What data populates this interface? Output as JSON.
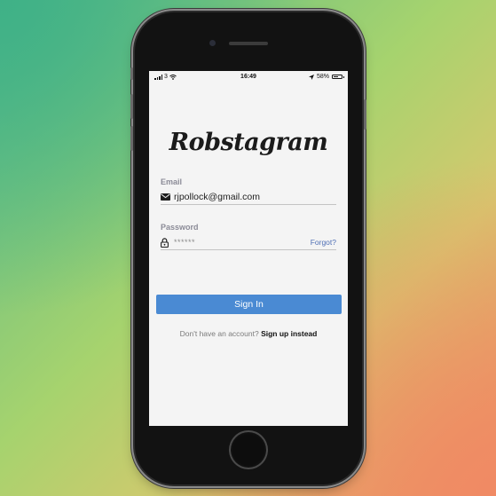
{
  "status_bar": {
    "carrier": "3",
    "time": "16:49",
    "battery": "58%",
    "battery_level": 0.58
  },
  "app": {
    "logo": "Robstagram"
  },
  "form": {
    "email_label": "Email",
    "email_value": "rjpollock@gmail.com",
    "password_label": "Password",
    "password_value": "******",
    "forgot_link": "Forgot?",
    "signin_button": "Sign In"
  },
  "signup": {
    "prompt": "Don't have an account?",
    "link": "Sign up instead"
  },
  "colors": {
    "primary": "#4a8ad3",
    "link": "#4f6fb5"
  },
  "icons": {
    "email": "mail-icon",
    "password": "lock-icon"
  }
}
